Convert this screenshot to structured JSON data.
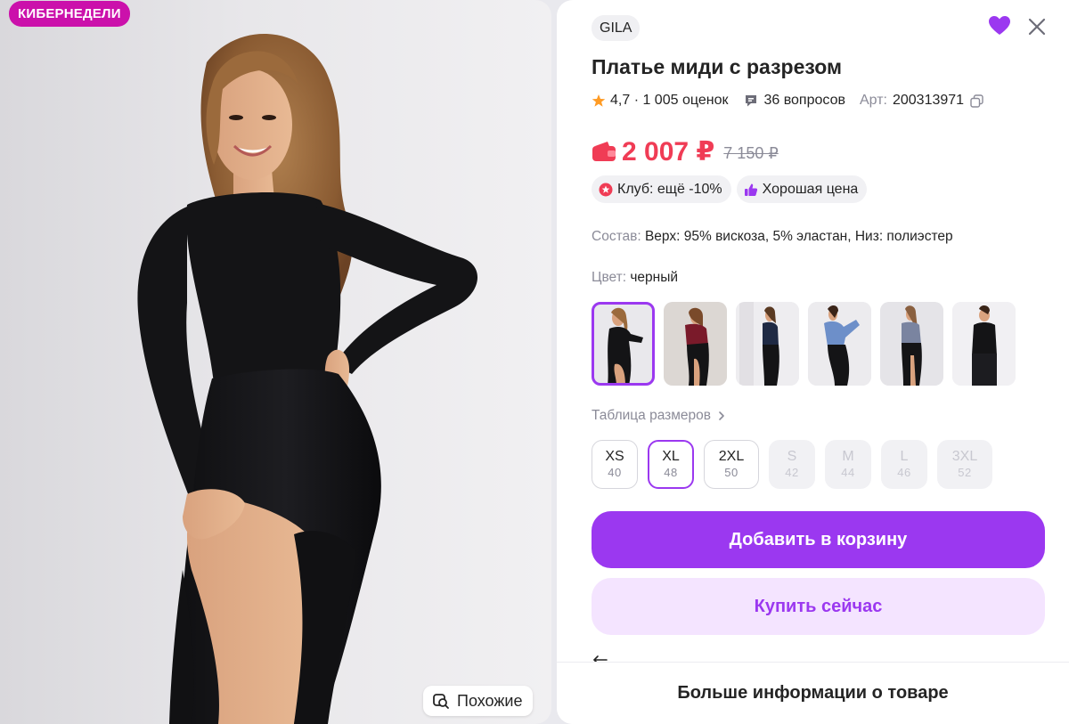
{
  "photo": {
    "promo_badge": "КИБЕРНЕДЕЛИ",
    "similar_button": "Похожие"
  },
  "product": {
    "brand": "GILA",
    "title": "Платье миди с разрезом",
    "rating": "4,7 · 1 005 оценок",
    "questions": "36 вопросов",
    "article_label": "Арт:",
    "article": "200313971",
    "price": "2 007 ₽",
    "old_price": "7 150 ₽",
    "tags": [
      {
        "label": "Клуб: ещё -10%",
        "icon": "club-star-icon"
      },
      {
        "label": "Хорошая цена",
        "icon": "thumbs-up-icon"
      }
    ],
    "composition_label": "Состав:",
    "composition": "Верх: 95% вискоза, 5% эластан, Низ: полиэстер",
    "color_label": "Цвет:",
    "color": "черный",
    "size_table": "Таблица размеров",
    "sizes": [
      {
        "size": "XS",
        "ru": "40",
        "state": "available"
      },
      {
        "size": "XL",
        "ru": "48",
        "state": "selected"
      },
      {
        "size": "2XL",
        "ru": "50",
        "state": "available"
      },
      {
        "size": "S",
        "ru": "42",
        "state": "disabled"
      },
      {
        "size": "M",
        "ru": "44",
        "state": "disabled"
      },
      {
        "size": "L",
        "ru": "46",
        "state": "disabled"
      },
      {
        "size": "3XL",
        "ru": "52",
        "state": "disabled"
      }
    ]
  },
  "actions": {
    "add_to_cart": "Добавить в корзину",
    "buy_now": "Купить сейчас",
    "more_info": "Больше информации о товаре"
  },
  "colors": {
    "accent": "#9b38f0",
    "price": "#f03c55",
    "promo": "#cb11ab",
    "buy_bg": "#f4e4ff"
  }
}
